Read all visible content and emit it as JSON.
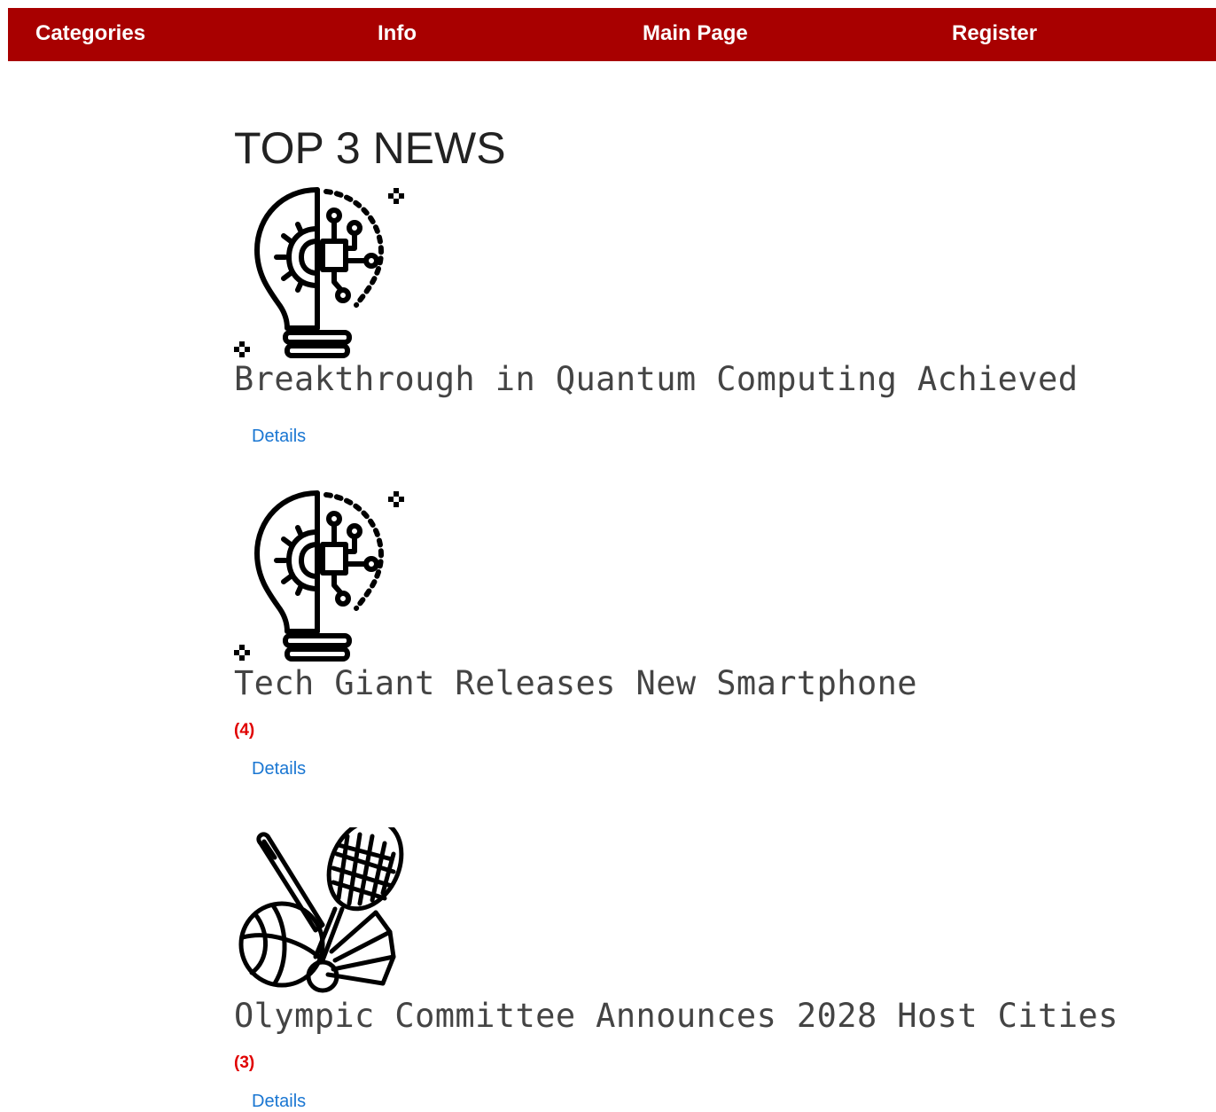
{
  "nav": {
    "categories": "Categories",
    "info": "Info",
    "main_page": "Main Page",
    "register": "Register"
  },
  "page": {
    "title": "TOP 3 NEWS"
  },
  "news": [
    {
      "title": "Breakthrough in Quantum Computing Achieved",
      "count": "",
      "details_label": "Details",
      "icon": "lightbulb-circuit-icon"
    },
    {
      "title": "Tech Giant Releases New Smartphone",
      "count": "(4)",
      "details_label": "Details",
      "icon": "lightbulb-circuit-icon"
    },
    {
      "title": "Olympic Committee Announces 2028 Host Cities",
      "count": "(3)",
      "details_label": "Details",
      "icon": "sports-equipment-icon"
    }
  ],
  "colors": {
    "navbar_bg": "#a80000",
    "link": "#1976d2",
    "count": "#e00000"
  }
}
